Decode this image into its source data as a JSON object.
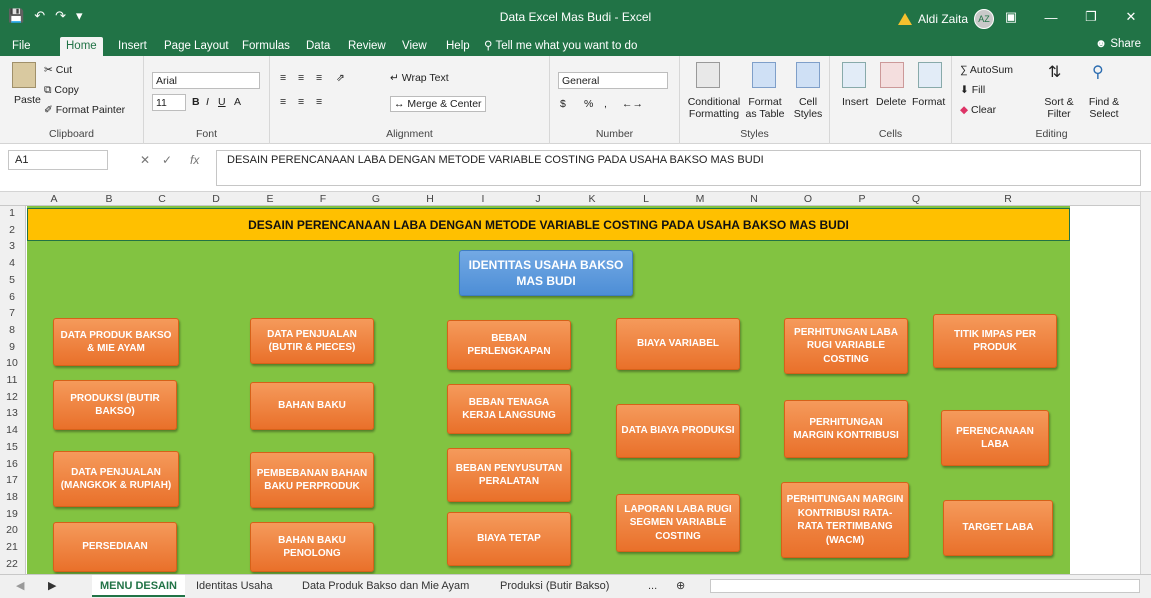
{
  "window": {
    "title": "Data Excel Mas Budi  -  Excel",
    "user": "Aldi Zaita",
    "user_initials": "AZ",
    "share": "Share"
  },
  "tabs": [
    "File",
    "Home",
    "Insert",
    "Page Layout",
    "Formulas",
    "Data",
    "Review",
    "View",
    "Help",
    "Tell me what you want to do"
  ],
  "ribbon": {
    "clipboard": {
      "paste": "Paste",
      "cut": "Cut",
      "copy": "Copy",
      "format_painter": "Format Painter",
      "label": "Clipboard"
    },
    "font": {
      "name": "Arial",
      "size": "11",
      "label": "Font"
    },
    "alignment": {
      "wrap": "Wrap Text",
      "merge": "Merge & Center",
      "label": "Alignment"
    },
    "number": {
      "format": "General",
      "label": "Number"
    },
    "styles": {
      "conditional": "Conditional Formatting",
      "format_as": "Format as Table",
      "cell_styles": "Cell Styles",
      "label": "Styles"
    },
    "cells": {
      "insert": "Insert",
      "delete": "Delete",
      "format": "Format",
      "label": "Cells"
    },
    "editing": {
      "autosum": "AutoSum",
      "fill": "Fill",
      "clear": "Clear",
      "sort": "Sort & Filter",
      "find": "Find & Select",
      "label": "Editing"
    }
  },
  "formula_bar": {
    "name_box": "A1",
    "formula": "DESAIN PERENCANAAN LABA DENGAN METODE VARIABLE COSTING PADA USAHA BAKSO MAS BUDI"
  },
  "columns": [
    "A",
    "B",
    "C",
    "D",
    "E",
    "F",
    "G",
    "H",
    "I",
    "J",
    "K",
    "L",
    "M",
    "N",
    "O",
    "P",
    "Q",
    "R"
  ],
  "rows": [
    "1",
    "2",
    "3",
    "4",
    "5",
    "6",
    "7",
    "8",
    "9",
    "10",
    "11",
    "12",
    "13",
    "14",
    "15",
    "16",
    "17",
    "18",
    "19",
    "20",
    "21",
    "22"
  ],
  "sheet": {
    "banner": "DESAIN PERENCANAAN LABA DENGAN METODE VARIABLE COSTING PADA USAHA BAKSO MAS BUDI",
    "identity_button": "IDENTITAS USAHA BAKSO MAS BUDI",
    "buttons": [
      "DATA PRODUK BAKSO & MIE AYAM",
      "PRODUKSI (BUTIR BAKSO)",
      "DATA PENJUALAN (MANGKOK & RUPIAH)",
      "PERSEDIAAN",
      "DATA PENJUALAN (BUTIR & PIECES)",
      "BAHAN BAKU",
      "PEMBEBANAN BAHAN BAKU PERPRODUK",
      "BAHAN BAKU PENOLONG",
      "BEBAN PERLENGKAPAN",
      "BEBAN TENAGA KERJA LANGSUNG",
      "BEBAN PENYUSUTAN PERALATAN",
      "BIAYA TETAP",
      "BIAYA VARIABEL",
      "DATA BIAYA PRODUKSI",
      "LAPORAN LABA RUGI SEGMEN VARIABLE COSTING",
      "PERHITUNGAN LABA RUGI VARIABLE COSTING",
      "PERHITUNGAN MARGIN KONTRIBUSI",
      "PERHITUNGAN MARGIN KONTRIBUSI RATA-RATA TERTIMBANG (WACM)",
      "TITIK IMPAS PER PRODUK",
      "PERENCANAAN LABA",
      "TARGET LABA"
    ]
  },
  "sheet_tabs": [
    "MENU DESAIN",
    "Identitas Usaha",
    "Data Produk Bakso dan Mie Ayam",
    "Produksi (Butir Bakso)",
    "..."
  ]
}
